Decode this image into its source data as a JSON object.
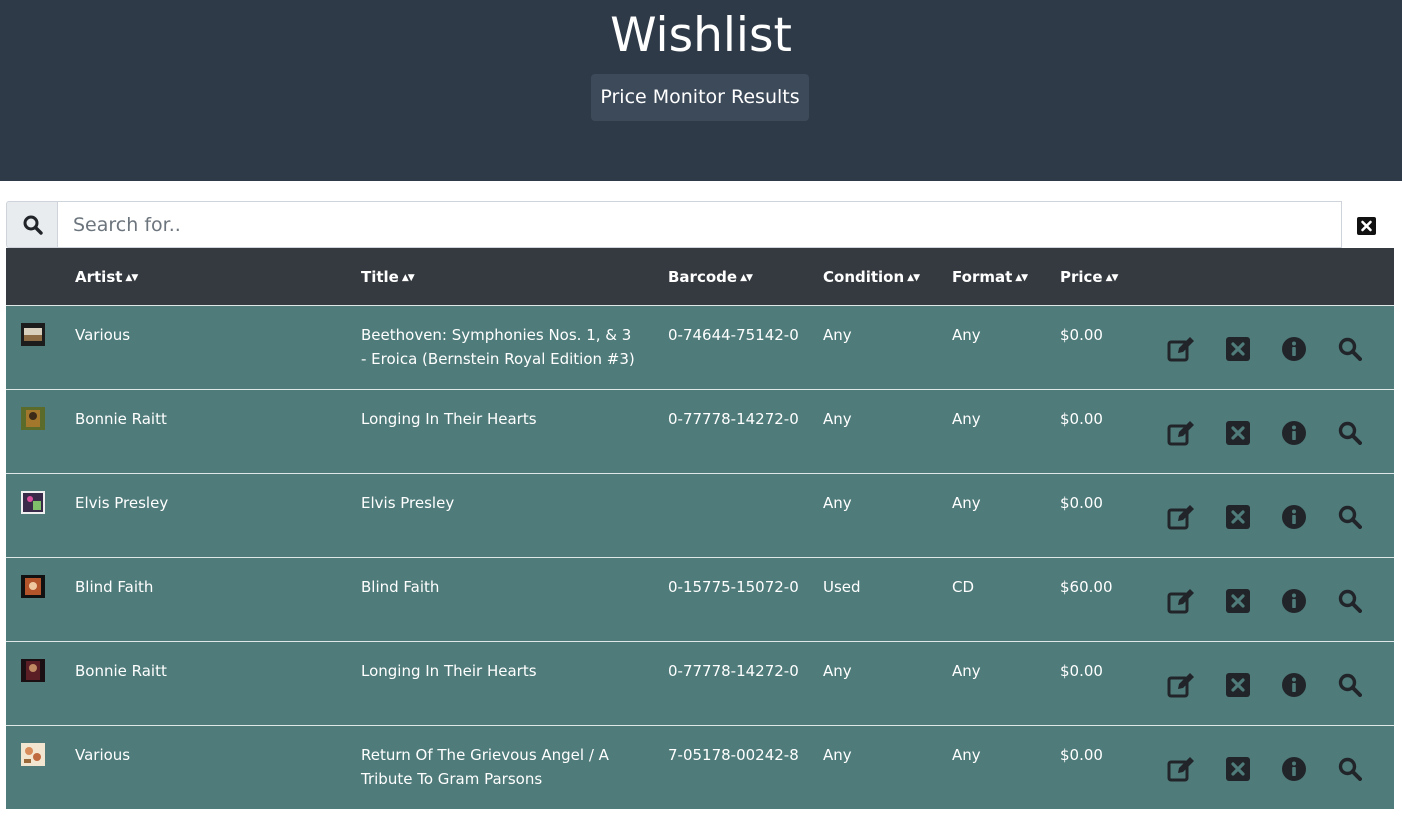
{
  "header": {
    "title": "Wishlist",
    "price_monitor_label": "Price Monitor Results"
  },
  "search": {
    "placeholder": "Search for..",
    "value": ""
  },
  "columns": [
    "Artist",
    "Title",
    "Barcode",
    "Condition",
    "Format",
    "Price"
  ],
  "rows": [
    {
      "artist": "Various",
      "title": "Beethoven: Symphonies Nos. 1, & 3 - Eroica (Bernstein Royal Edition #3)",
      "barcode": "0-74644-75142-0",
      "condition": "Any",
      "format": "Any",
      "price": "$0.00"
    },
    {
      "artist": "Bonnie Raitt",
      "title": "Longing In Their Hearts",
      "barcode": "0-77778-14272-0",
      "condition": "Any",
      "format": "Any",
      "price": "$0.00"
    },
    {
      "artist": "Elvis Presley",
      "title": "Elvis Presley",
      "barcode": "",
      "condition": "Any",
      "format": "Any",
      "price": "$0.00"
    },
    {
      "artist": "Blind Faith",
      "title": "Blind Faith",
      "barcode": "0-15775-15072-0",
      "condition": "Used",
      "format": "CD",
      "price": "$60.00"
    },
    {
      "artist": "Bonnie Raitt",
      "title": "Longing In Their Hearts",
      "barcode": "0-77778-14272-0",
      "condition": "Any",
      "format": "Any",
      "price": "$0.00"
    },
    {
      "artist": "Various",
      "title": "Return Of The Grievous Angel / A Tribute To Gram Parsons",
      "barcode": "7-05178-00242-8",
      "condition": "Any",
      "format": "Any",
      "price": "$0.00"
    }
  ],
  "icons": {
    "search": "search-icon",
    "clear": "clear-icon",
    "edit": "edit-icon",
    "delete": "delete-icon",
    "info": "info-icon",
    "lookup": "search-icon"
  },
  "colors": {
    "header_bg": "#2f3a48",
    "table_header_bg": "#343a40",
    "row_bg": "#4f7b7a",
    "button_bg": "#3d4a5a",
    "icon_dark": "#212529"
  }
}
